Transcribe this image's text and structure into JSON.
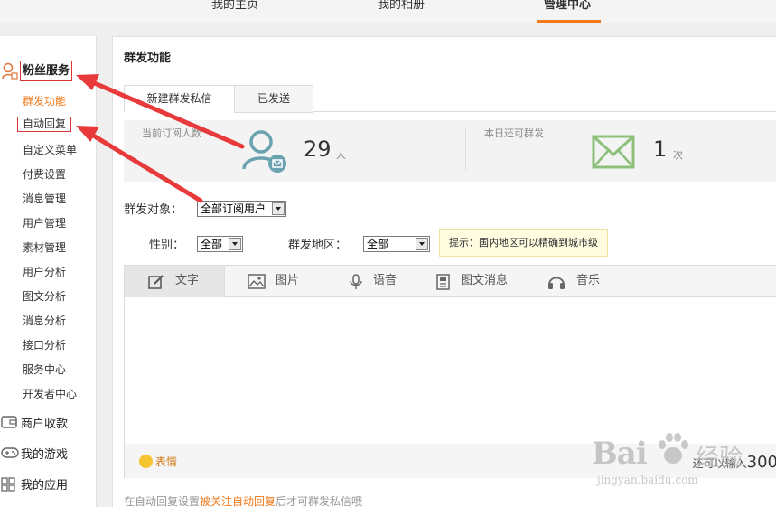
{
  "topnav": {
    "items": [
      {
        "label": "我的主页"
      },
      {
        "label": "我的相册"
      },
      {
        "label": "管理中心"
      }
    ],
    "active_index": 2
  },
  "sidebar": {
    "section_title": "粉丝服务",
    "items": [
      {
        "label": "群发功能"
      },
      {
        "label": "自动回复"
      },
      {
        "label": "自定义菜单"
      },
      {
        "label": "付费设置"
      },
      {
        "label": "消息管理"
      },
      {
        "label": "用户管理"
      },
      {
        "label": "素材管理"
      },
      {
        "label": "用户分析"
      },
      {
        "label": "图文分析"
      },
      {
        "label": "消息分析"
      },
      {
        "label": "接口分析"
      },
      {
        "label": "服务中心"
      },
      {
        "label": "开发者中心"
      }
    ],
    "active_item": "群发功能",
    "groups": [
      {
        "label": "商户收款",
        "icon": "wallet-icon"
      },
      {
        "label": "我的游戏",
        "icon": "gamepad-icon"
      },
      {
        "label": "我的应用",
        "icon": "apps-grid-icon"
      }
    ]
  },
  "main": {
    "title": "群发功能",
    "tabs": [
      {
        "label": "新建群发私信"
      },
      {
        "label": "已发送"
      }
    ],
    "stats": {
      "subscribers": {
        "label": "当前订阅人数",
        "value": "29",
        "unit": "人"
      },
      "remaining": {
        "label": "本日还可群发",
        "value": "1",
        "unit": "次"
      }
    },
    "filters": {
      "target_label": "群发对象：",
      "target_value": "全部订阅用户",
      "gender_label": "性别：",
      "gender_value": "全部",
      "region_label": "群发地区：",
      "region_value": "全部",
      "hint": "提示：国内地区可以精确到城市级"
    },
    "editor": {
      "tools": [
        {
          "label": "文字",
          "icon": "edit-icon"
        },
        {
          "label": "图片",
          "icon": "image-icon"
        },
        {
          "label": "语音",
          "icon": "microphone-icon"
        },
        {
          "label": "图文消息",
          "icon": "document-icon"
        },
        {
          "label": "音乐",
          "icon": "headphones-icon"
        }
      ],
      "active_tool": "文字",
      "emoji_label": "表情",
      "counter_text": "还可以输入",
      "counter_value": "300"
    },
    "bottom_note": {
      "prefix": "在自动回复设置",
      "link": "被关注自动回复",
      "suffix": "后才可群发私信哦"
    }
  },
  "watermark": {
    "brand": "Bai",
    "brand_cn": "经验",
    "url": "jingyan.baidu.com"
  },
  "colors": {
    "accent": "#f07a1c",
    "annotation_red": "#e83a3a",
    "stats_icon": "#6aa2b0",
    "envelope_icon": "#8cc07a",
    "hint_bg": "#fffce0"
  }
}
